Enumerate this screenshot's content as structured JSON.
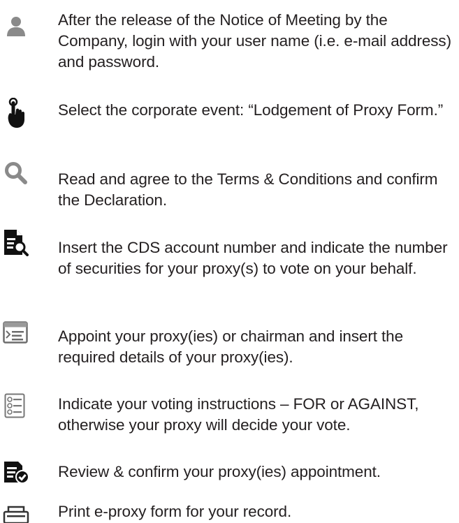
{
  "steps": [
    {
      "icon": "user-icon",
      "text": "After the release of the Notice of Meeting by the Company, login with your user name (i.e. e-mail address) and password."
    },
    {
      "icon": "pointer-hand-icon",
      "text": "Select the corporate event: “Lodgement of Proxy Form.”"
    },
    {
      "icon": "magnifier-icon",
      "text": "Read and agree to the Terms & Conditions and confirm the Declaration."
    },
    {
      "icon": "document-search-icon",
      "text": "Insert the CDS account number and indicate the number of securities for your proxy(s) to vote on your behalf."
    },
    {
      "icon": "form-window-icon",
      "text": "Appoint your proxy(ies) or chairman and insert the required details of your proxy(ies)."
    },
    {
      "icon": "checklist-icon",
      "text": "Indicate your voting instructions – FOR or AGAINST, otherwise your proxy will decide your vote."
    },
    {
      "icon": "document-check-icon",
      "text": "Review & confirm your proxy(ies) appointment."
    },
    {
      "icon": "printer-icon",
      "text": "Print e-proxy form for your record."
    }
  ]
}
